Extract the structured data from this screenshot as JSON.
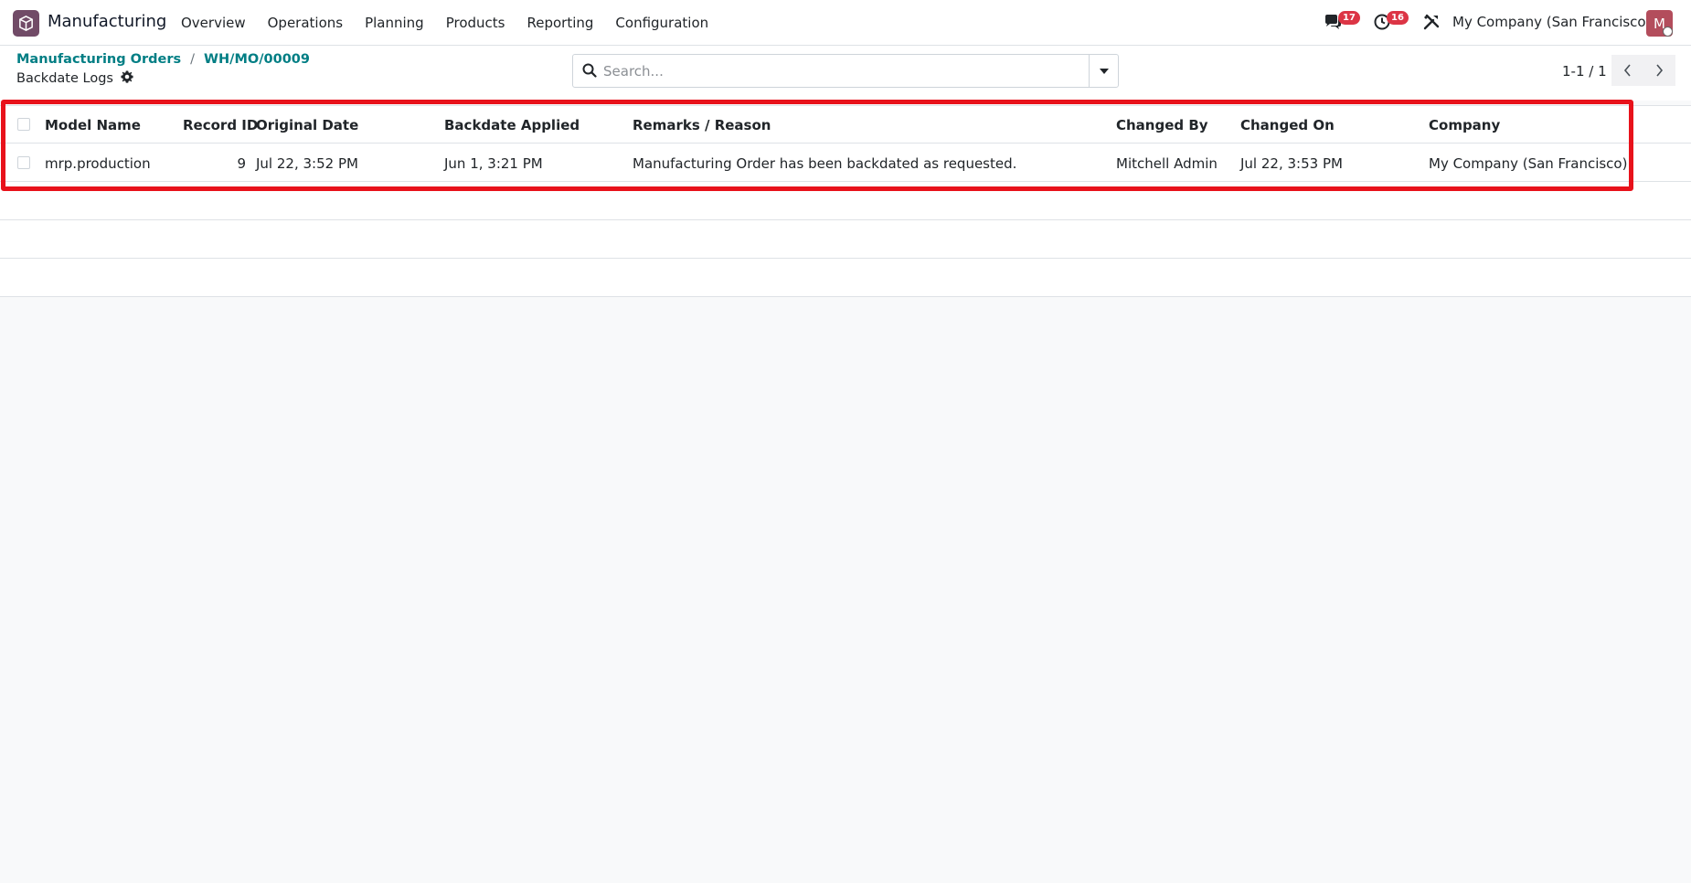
{
  "app": {
    "name": "Manufacturing",
    "brand_color": "#714b67"
  },
  "menu": [
    {
      "label": "Overview"
    },
    {
      "label": "Operations"
    },
    {
      "label": "Planning"
    },
    {
      "label": "Products"
    },
    {
      "label": "Reporting"
    },
    {
      "label": "Configuration"
    }
  ],
  "systray": {
    "messages_icon": "chat-icon",
    "messages_count": "17",
    "activities_icon": "clock-icon",
    "activities_count": "16",
    "debug_icon": "tools-icon",
    "company": "My Company (San Francisco)",
    "avatar_initial": "M"
  },
  "breadcrumb": [
    {
      "label": "Manufacturing Orders"
    },
    {
      "label": "WH/MO/00009"
    }
  ],
  "page": {
    "title": "Backdate Logs",
    "settings_icon": "gear-icon"
  },
  "search": {
    "placeholder": "Search...",
    "value": ""
  },
  "pager": {
    "value": "1-1 / 1"
  },
  "table": {
    "columns": [
      "Model Name",
      "Record ID",
      "Original Date",
      "Backdate Applied",
      "Remarks / Reason",
      "Changed By",
      "Changed On",
      "Company"
    ],
    "rows": [
      {
        "model_name": "mrp.production",
        "record_id": "9",
        "original_date": "Jul 22, 3:52 PM",
        "backdate_applied": "Jun 1, 3:21 PM",
        "remarks": "Manufacturing Order has been backdated as requested.",
        "changed_by": "Mitchell Admin",
        "changed_on": "Jul 22, 3:53 PM",
        "company": "My Company (San Francisco)"
      }
    ]
  },
  "colors": {
    "link": "#017e84",
    "badge": "#dc3545",
    "highlight": "#e8121b",
    "avatar": "#b34d5c"
  }
}
